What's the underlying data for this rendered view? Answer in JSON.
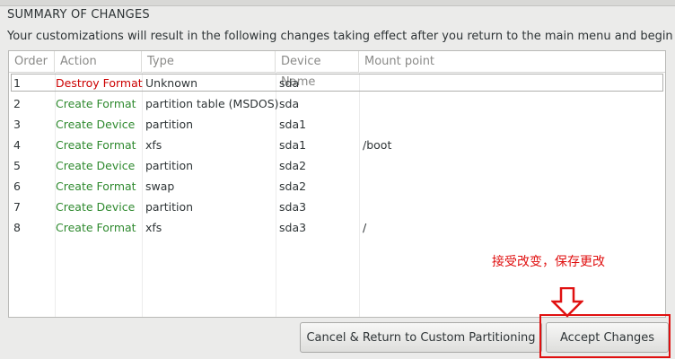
{
  "dialog": {
    "title": "SUMMARY OF CHANGES",
    "description": "Your customizations will result in the following changes taking effect after you return to the main menu and begin installation:"
  },
  "table": {
    "headers": {
      "order": "Order",
      "action": "Action",
      "type": "Type",
      "device": "Device Name",
      "mount": "Mount point"
    },
    "rows": [
      {
        "order": "1",
        "action": "Destroy Format",
        "type": "Unknown",
        "device": "sda",
        "mount": ""
      },
      {
        "order": "2",
        "action": "Create Format",
        "type": "partition table (MSDOS)",
        "device": "sda",
        "mount": ""
      },
      {
        "order": "3",
        "action": "Create Device",
        "type": "partition",
        "device": "sda1",
        "mount": ""
      },
      {
        "order": "4",
        "action": "Create Format",
        "type": "xfs",
        "device": "sda1",
        "mount": "/boot"
      },
      {
        "order": "5",
        "action": "Create Device",
        "type": "partition",
        "device": "sda2",
        "mount": ""
      },
      {
        "order": "6",
        "action": "Create Format",
        "type": "swap",
        "device": "sda2",
        "mount": ""
      },
      {
        "order": "7",
        "action": "Create Device",
        "type": "partition",
        "device": "sda3",
        "mount": ""
      },
      {
        "order": "8",
        "action": "Create Format",
        "type": "xfs",
        "device": "sda3",
        "mount": "/"
      }
    ]
  },
  "annotation": {
    "text": "接受改变，保存更改"
  },
  "buttons": {
    "cancel_label": "Cancel & Return to Custom Partitioning",
    "accept_label": "Accept Changes"
  },
  "colors": {
    "destroy_action": "#cc0000",
    "create_action": "#2f8a2f",
    "annotation": "#e01010"
  },
  "icons": {
    "annotation_arrow": "down-arrow-icon"
  }
}
